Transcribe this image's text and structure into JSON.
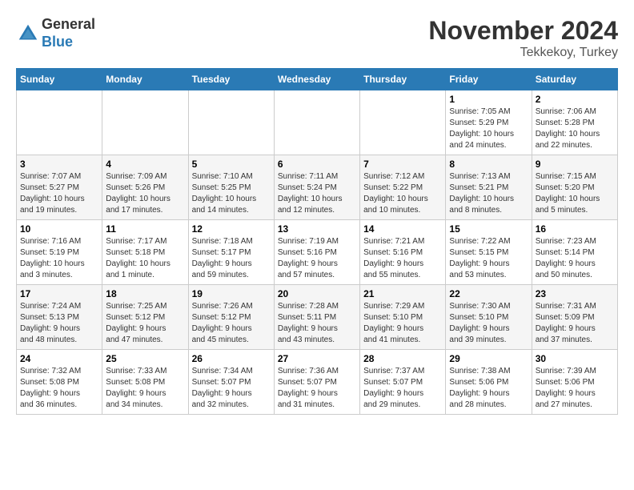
{
  "header": {
    "logo_general": "General",
    "logo_blue": "Blue",
    "month_title": "November 2024",
    "location": "Tekkekoy, Turkey"
  },
  "days_of_week": [
    "Sunday",
    "Monday",
    "Tuesday",
    "Wednesday",
    "Thursday",
    "Friday",
    "Saturday"
  ],
  "weeks": [
    [
      {
        "day": "",
        "info": ""
      },
      {
        "day": "",
        "info": ""
      },
      {
        "day": "",
        "info": ""
      },
      {
        "day": "",
        "info": ""
      },
      {
        "day": "",
        "info": ""
      },
      {
        "day": "1",
        "info": "Sunrise: 7:05 AM\nSunset: 5:29 PM\nDaylight: 10 hours\nand 24 minutes."
      },
      {
        "day": "2",
        "info": "Sunrise: 7:06 AM\nSunset: 5:28 PM\nDaylight: 10 hours\nand 22 minutes."
      }
    ],
    [
      {
        "day": "3",
        "info": "Sunrise: 7:07 AM\nSunset: 5:27 PM\nDaylight: 10 hours\nand 19 minutes."
      },
      {
        "day": "4",
        "info": "Sunrise: 7:09 AM\nSunset: 5:26 PM\nDaylight: 10 hours\nand 17 minutes."
      },
      {
        "day": "5",
        "info": "Sunrise: 7:10 AM\nSunset: 5:25 PM\nDaylight: 10 hours\nand 14 minutes."
      },
      {
        "day": "6",
        "info": "Sunrise: 7:11 AM\nSunset: 5:24 PM\nDaylight: 10 hours\nand 12 minutes."
      },
      {
        "day": "7",
        "info": "Sunrise: 7:12 AM\nSunset: 5:22 PM\nDaylight: 10 hours\nand 10 minutes."
      },
      {
        "day": "8",
        "info": "Sunrise: 7:13 AM\nSunset: 5:21 PM\nDaylight: 10 hours\nand 8 minutes."
      },
      {
        "day": "9",
        "info": "Sunrise: 7:15 AM\nSunset: 5:20 PM\nDaylight: 10 hours\nand 5 minutes."
      }
    ],
    [
      {
        "day": "10",
        "info": "Sunrise: 7:16 AM\nSunset: 5:19 PM\nDaylight: 10 hours\nand 3 minutes."
      },
      {
        "day": "11",
        "info": "Sunrise: 7:17 AM\nSunset: 5:18 PM\nDaylight: 10 hours\nand 1 minute."
      },
      {
        "day": "12",
        "info": "Sunrise: 7:18 AM\nSunset: 5:17 PM\nDaylight: 9 hours\nand 59 minutes."
      },
      {
        "day": "13",
        "info": "Sunrise: 7:19 AM\nSunset: 5:16 PM\nDaylight: 9 hours\nand 57 minutes."
      },
      {
        "day": "14",
        "info": "Sunrise: 7:21 AM\nSunset: 5:16 PM\nDaylight: 9 hours\nand 55 minutes."
      },
      {
        "day": "15",
        "info": "Sunrise: 7:22 AM\nSunset: 5:15 PM\nDaylight: 9 hours\nand 53 minutes."
      },
      {
        "day": "16",
        "info": "Sunrise: 7:23 AM\nSunset: 5:14 PM\nDaylight: 9 hours\nand 50 minutes."
      }
    ],
    [
      {
        "day": "17",
        "info": "Sunrise: 7:24 AM\nSunset: 5:13 PM\nDaylight: 9 hours\nand 48 minutes."
      },
      {
        "day": "18",
        "info": "Sunrise: 7:25 AM\nSunset: 5:12 PM\nDaylight: 9 hours\nand 47 minutes."
      },
      {
        "day": "19",
        "info": "Sunrise: 7:26 AM\nSunset: 5:12 PM\nDaylight: 9 hours\nand 45 minutes."
      },
      {
        "day": "20",
        "info": "Sunrise: 7:28 AM\nSunset: 5:11 PM\nDaylight: 9 hours\nand 43 minutes."
      },
      {
        "day": "21",
        "info": "Sunrise: 7:29 AM\nSunset: 5:10 PM\nDaylight: 9 hours\nand 41 minutes."
      },
      {
        "day": "22",
        "info": "Sunrise: 7:30 AM\nSunset: 5:10 PM\nDaylight: 9 hours\nand 39 minutes."
      },
      {
        "day": "23",
        "info": "Sunrise: 7:31 AM\nSunset: 5:09 PM\nDaylight: 9 hours\nand 37 minutes."
      }
    ],
    [
      {
        "day": "24",
        "info": "Sunrise: 7:32 AM\nSunset: 5:08 PM\nDaylight: 9 hours\nand 36 minutes."
      },
      {
        "day": "25",
        "info": "Sunrise: 7:33 AM\nSunset: 5:08 PM\nDaylight: 9 hours\nand 34 minutes."
      },
      {
        "day": "26",
        "info": "Sunrise: 7:34 AM\nSunset: 5:07 PM\nDaylight: 9 hours\nand 32 minutes."
      },
      {
        "day": "27",
        "info": "Sunrise: 7:36 AM\nSunset: 5:07 PM\nDaylight: 9 hours\nand 31 minutes."
      },
      {
        "day": "28",
        "info": "Sunrise: 7:37 AM\nSunset: 5:07 PM\nDaylight: 9 hours\nand 29 minutes."
      },
      {
        "day": "29",
        "info": "Sunrise: 7:38 AM\nSunset: 5:06 PM\nDaylight: 9 hours\nand 28 minutes."
      },
      {
        "day": "30",
        "info": "Sunrise: 7:39 AM\nSunset: 5:06 PM\nDaylight: 9 hours\nand 27 minutes."
      }
    ]
  ]
}
